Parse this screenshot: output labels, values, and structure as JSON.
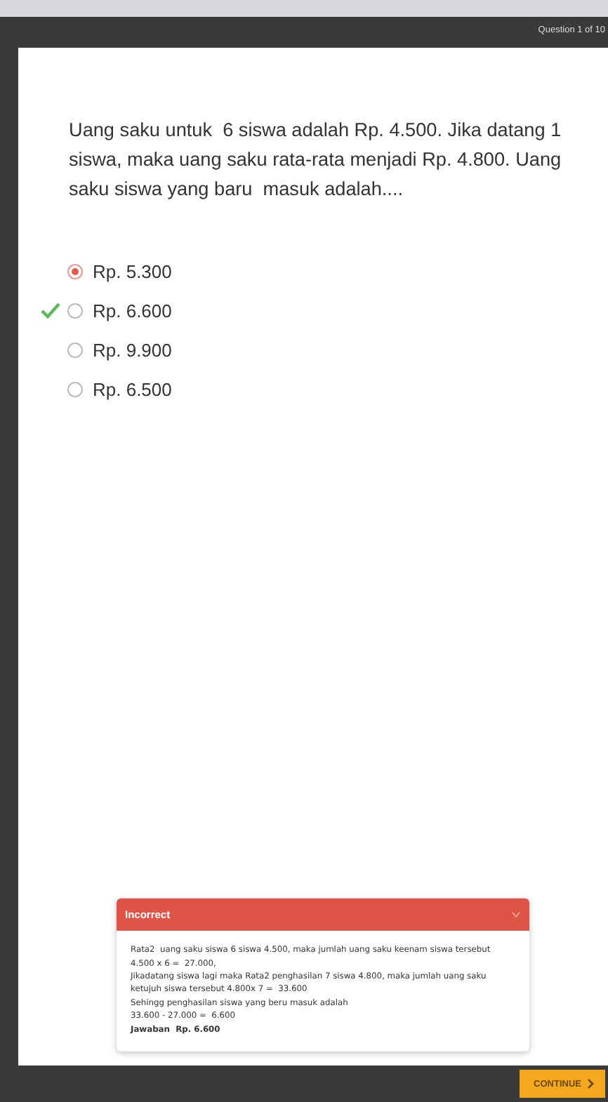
{
  "header": {
    "progress": "Question 1 of 10"
  },
  "question": "Uang saku untuk  6 siswa adalah Rp. 4.500. Jika datang 1 siswa, maka uang saku rata-rata menjadi Rp. 4.800. Uang saku siswa yang baru  masuk adalah....",
  "options": [
    {
      "label": "Rp. 5.300",
      "selected": true,
      "correct": false
    },
    {
      "label": "Rp. 6.600",
      "selected": false,
      "correct": true
    },
    {
      "label": "Rp. 9.900",
      "selected": false,
      "correct": false
    },
    {
      "label": "Rp. 6.500",
      "selected": false,
      "correct": false
    }
  ],
  "feedback": {
    "title": "Incorrect",
    "expanded": true,
    "lines": [
      "Rata2  uang saku siswa 6 siswa 4.500, maka jumlah uang saku keenam siswa tersebut 4.500 x 6 =  27.000,",
      "Jikadatang siswa lagi maka Rata2 penghasilan 7 siswa 4.800, maka jumlah uang saku ketujuh siswa tersebut 4.800x 7 =  33.600",
      "Sehingg penghasilan siswa yang beru masuk adalah",
      "33.600 - 27.000 =  6.600"
    ],
    "answer": "Jawaban  Rp. 6.600"
  },
  "footer": {
    "button": "CONTINUE"
  }
}
